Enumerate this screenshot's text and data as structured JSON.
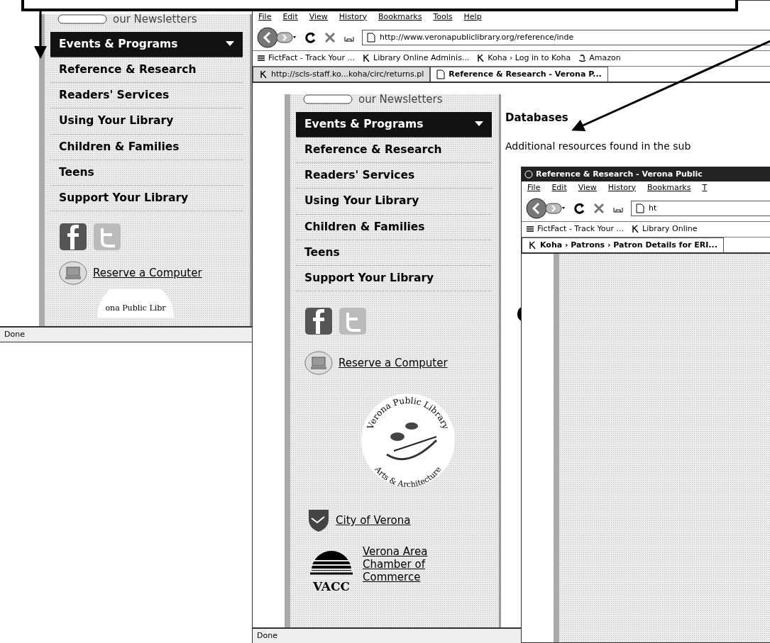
{
  "back_window": {
    "sidebar": {
      "newsletter_text": "our Newsletters",
      "nav": [
        {
          "label": "Events & Programs",
          "selected": true,
          "has_menu": true
        },
        {
          "label": "Reference & Research",
          "selected": false,
          "has_menu": false
        },
        {
          "label": "Readers' Services",
          "selected": false,
          "has_menu": false
        },
        {
          "label": "Using Your Library",
          "selected": false,
          "has_menu": false
        },
        {
          "label": "Children & Families",
          "selected": false,
          "has_menu": false
        },
        {
          "label": "Teens",
          "selected": false,
          "has_menu": false
        },
        {
          "label": "Support Your Library",
          "selected": false,
          "has_menu": false
        }
      ],
      "reserve_link": "Reserve a Computer",
      "logo_text": "ona Public Libr"
    },
    "status": "Done"
  },
  "front_window": {
    "menu": [
      "File",
      "Edit",
      "View",
      "History",
      "Bookmarks",
      "Tools",
      "Help"
    ],
    "url": "http://www.veronapubliclibrary.org/reference/inde",
    "bookmarks": [
      {
        "label": "FictFact - Track Your ...",
        "kind": "stack"
      },
      {
        "label": "Library Online Adminis...",
        "kind": "koha"
      },
      {
        "label": "Koha › Log in to Koha",
        "kind": "koha"
      },
      {
        "label": "Amazon",
        "kind": "amazon"
      }
    ],
    "tabs": [
      {
        "label": "http://scls-staff.ko...koha/circ/returns.pl",
        "selected": false,
        "kind": "koha"
      },
      {
        "label": "Reference & Research - Verona P...",
        "selected": true,
        "kind": "page"
      }
    ],
    "sidebar": {
      "newsletter_text": "our Newsletters",
      "nav": [
        {
          "label": "Events & Programs",
          "selected": true,
          "has_menu": true
        },
        {
          "label": "Reference & Research",
          "selected": false,
          "has_menu": false
        },
        {
          "label": "Readers' Services",
          "selected": false,
          "has_menu": false
        },
        {
          "label": "Using Your Library",
          "selected": false,
          "has_menu": false
        },
        {
          "label": "Children & Families",
          "selected": false,
          "has_menu": false
        },
        {
          "label": "Teens",
          "selected": false,
          "has_menu": false
        },
        {
          "label": "Support Your Library",
          "selected": false,
          "has_menu": false
        }
      ],
      "reserve_link": "Reserve a Computer",
      "logo_text": "Verona Public Library",
      "logo_subtext": "Arts & Architecture",
      "city_link": "City of Verona",
      "chamber_link": "Verona Area Chamber of Commerce",
      "chamber_logo_text": "VACC"
    },
    "heading": "Databases",
    "intro": "Additional resources found in the sub",
    "inner_window": {
      "title": "Reference & Research - Verona Public",
      "menu": [
        "File",
        "Edit",
        "View",
        "History",
        "Bookmarks",
        "T"
      ],
      "url": "ht",
      "bookmarks": [
        {
          "label": "FictFact - Track Your ...",
          "kind": "stack"
        },
        {
          "label": "Library Online",
          "kind": "koha"
        }
      ],
      "tabs": [
        {
          "label": "Koha › Patrons › Patron Details for ERI...",
          "selected": true,
          "kind": "koha"
        }
      ]
    },
    "status": "Done"
  }
}
